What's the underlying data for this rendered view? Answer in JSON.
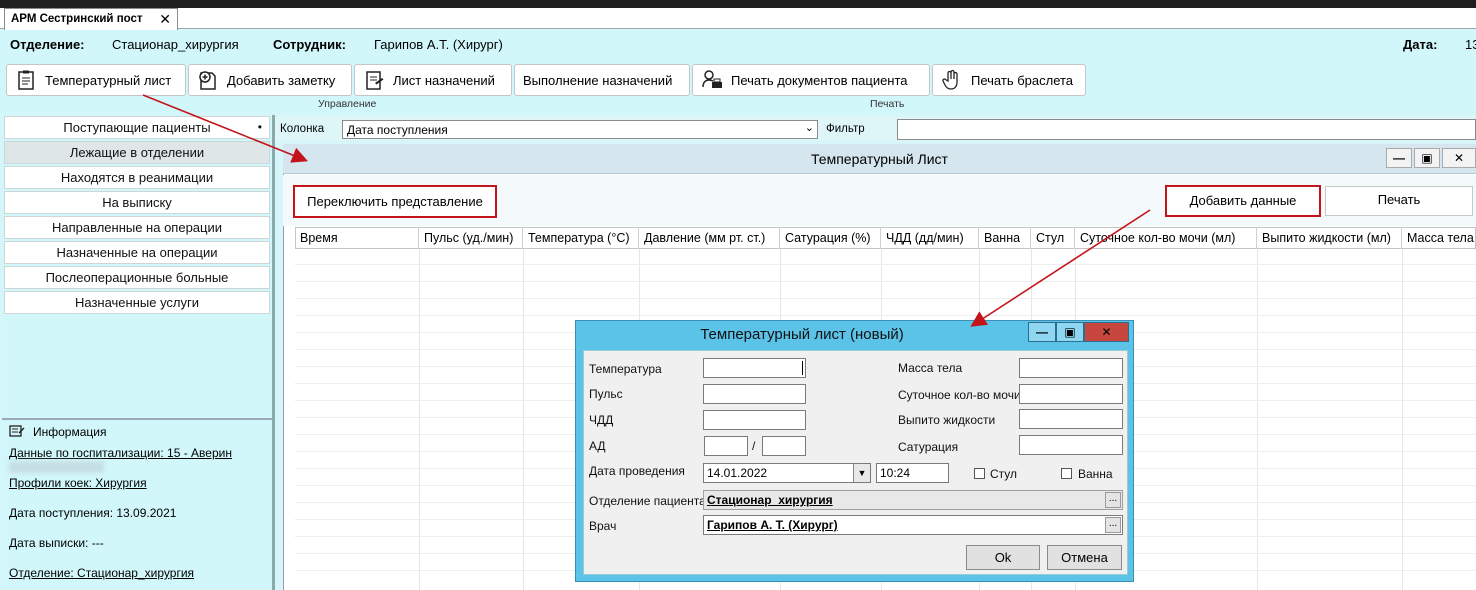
{
  "app": {
    "tab_title": "АРМ Сестринский пост",
    "tab_close": "✕"
  },
  "header": {
    "dept_label": "Отделение:",
    "dept_value": "Стационар_хирургия",
    "employee_label": "Сотрудник:",
    "employee_value": "Гарипов А.Т. (Хирург)",
    "date_label": "Дата:",
    "date_value": "13"
  },
  "toolbar": {
    "temperature_sheet": "Температурный лист",
    "add_note": "Добавить заметку",
    "prescriptions_sheet": "Лист назначений",
    "prescriptions_exec": "Выполнение назначений",
    "print_docs": "Печать документов пациента",
    "print_bracelet": "Печать браслета",
    "group_manage": "Управление",
    "group_print": "Печать"
  },
  "sidebar": {
    "items": [
      {
        "label": "Поступающие пациенты"
      },
      {
        "label": "Лежащие в отделении"
      },
      {
        "label": "Находятся в реанимации"
      },
      {
        "label": "На выписку"
      },
      {
        "label": "Направленные на операции"
      },
      {
        "label": "Назначенные на операции"
      },
      {
        "label": "Послеоперационные больные"
      },
      {
        "label": "Назначенные услуги"
      }
    ],
    "dot": "•"
  },
  "info": {
    "title": "Информация",
    "hospitalization": "Данные по госпитализации: 15 - Аверин",
    "bed_profiles": "Профили коек: Хирургия",
    "admission_date": "Дата поступления: 13.09.2021",
    "discharge_date": "Дата выписки: ---",
    "department": "Отделение: Стационар_хирургия"
  },
  "filter": {
    "column_label": "Колонка",
    "column_value": "Дата поступления",
    "filter_label": "Фильтр"
  },
  "temp_window": {
    "title": "Температурный Лист",
    "toggle_view": "Переключить представление",
    "add_data": "Добавить данные",
    "print": "Печать",
    "columns": [
      "Время",
      "Пульс (уд./мин)",
      "Температура (°C)",
      "Давление (мм рт. ст.)",
      "Сатурация (%)",
      "ЧДД (дд/мин)",
      "Ванна",
      "Стул",
      "Суточное кол-во мочи (мл)",
      "Выпито жидкости (мл)",
      "Масса тела"
    ]
  },
  "modal": {
    "title": "Температурный лист (новый)",
    "temperature": "Температура",
    "pulse": "Пульс",
    "rr": "ЧДД",
    "bp": "АД",
    "bp_sep": "/",
    "date_label": "Дата проведения",
    "date_value": "14.01.2022",
    "time_value": "10:24",
    "stool": "Стул",
    "bath": "Ванна",
    "weight": "Масса тела",
    "urine": "Суточное кол-во мочи",
    "fluid": "Выпито жидкости",
    "saturation": "Сатурация",
    "patient_dept_label": "Отделение пациента",
    "patient_dept_value": "Стационар_хирургия",
    "doctor_label": "Врач",
    "doctor_value": "Гарипов А. Т. (Хирург)",
    "ok": "Ok",
    "cancel": "Отмена"
  },
  "colors": {
    "accent_red": "#c4141b",
    "panel_cyan": "#d2f7fb",
    "modal_blue": "#5bc3e8"
  }
}
